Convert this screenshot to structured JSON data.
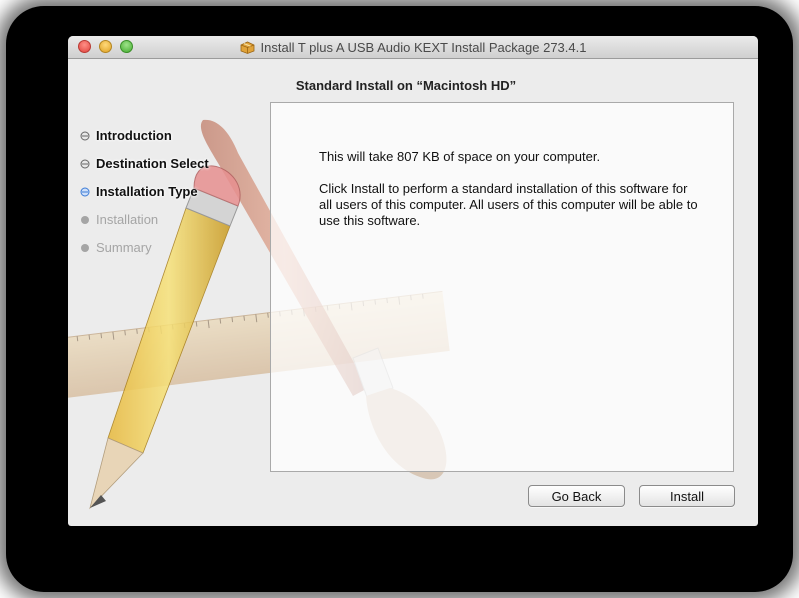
{
  "window": {
    "title": "Install T plus A USB Audio KEXT Install Package 273.4.1",
    "subtitle": "Standard Install on “Macintosh HD”"
  },
  "steps": [
    {
      "label": "Introduction",
      "state": "completed"
    },
    {
      "label": "Destination Select",
      "state": "completed"
    },
    {
      "label": "Installation Type",
      "state": "current"
    },
    {
      "label": "Installation",
      "state": "pending"
    },
    {
      "label": "Summary",
      "state": "pending"
    }
  ],
  "content": {
    "space_text": "This will take 807 KB of space on your computer.",
    "description": "Click Install to perform a standard installation of this software for all users of this computer. All users of this computer will be able to use this software."
  },
  "buttons": {
    "go_back": "Go Back",
    "install": "Install"
  },
  "colors": {
    "step_current": "#3b7bd6",
    "step_completed": "#666666",
    "step_pending": "#a5a5a5"
  },
  "icons": {
    "title": "package-icon",
    "background": "pencil-ruler-brush-art"
  }
}
